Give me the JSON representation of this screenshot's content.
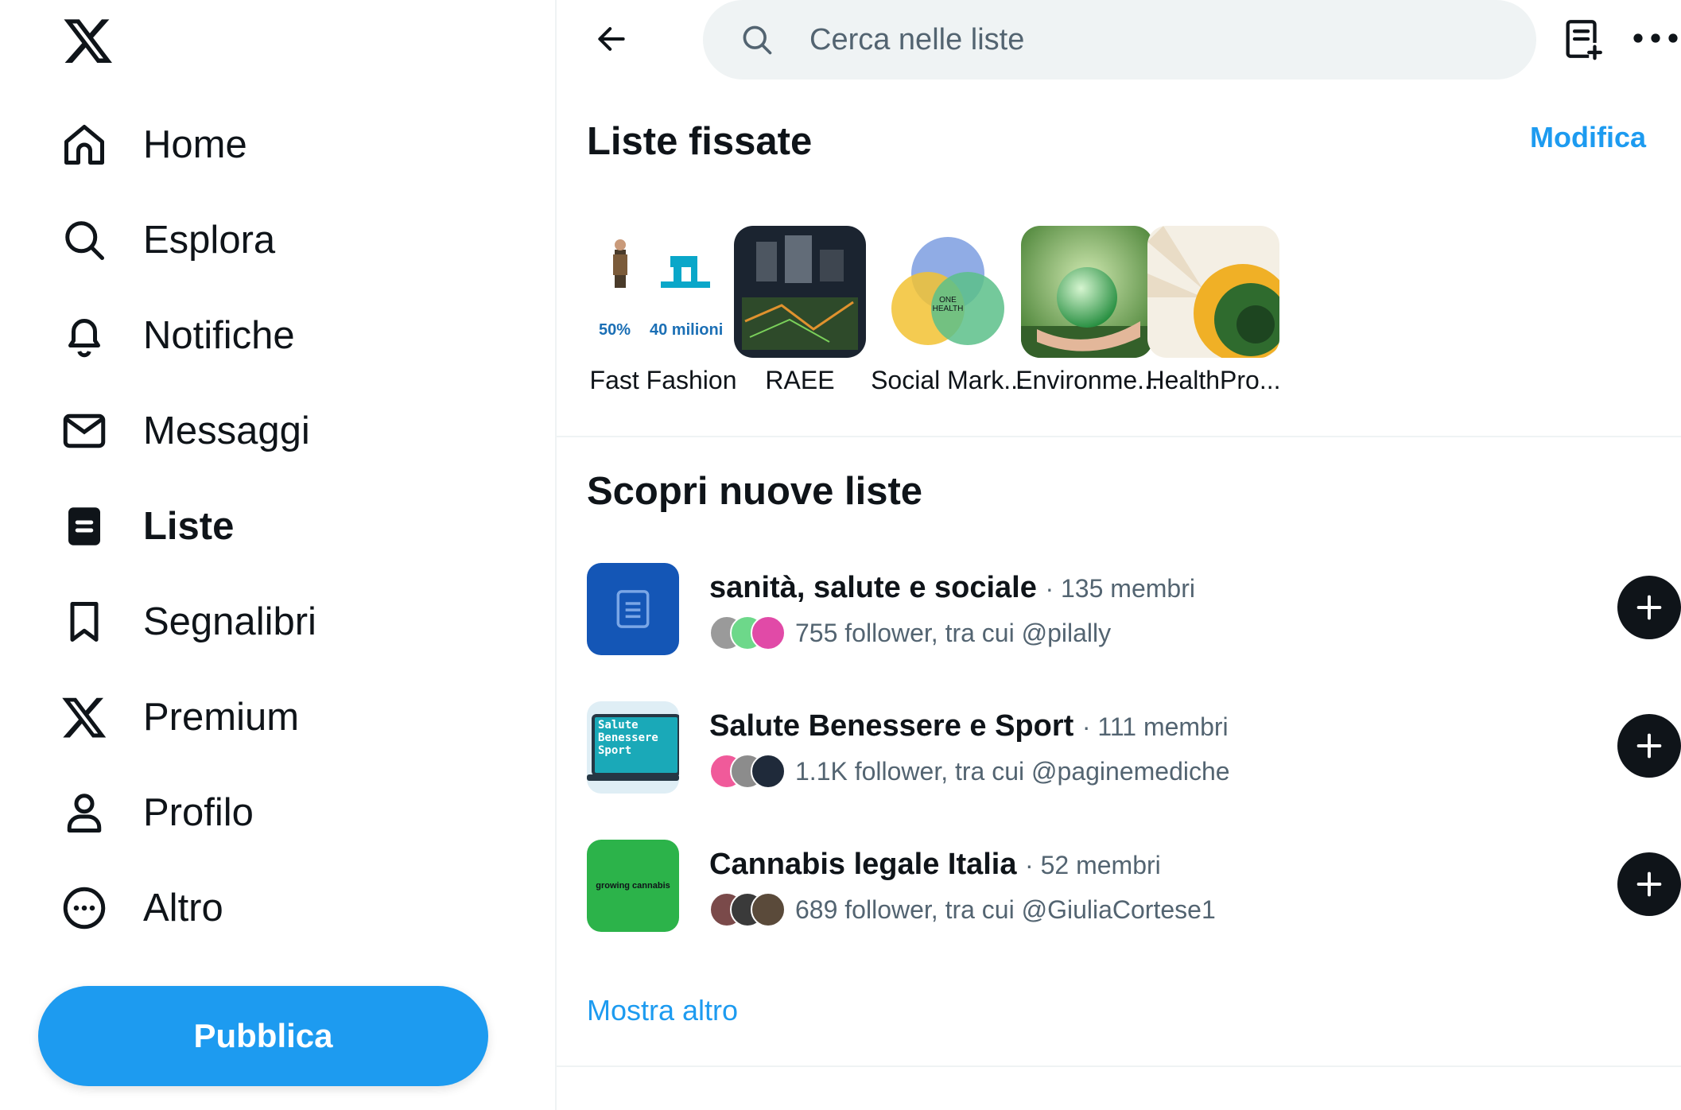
{
  "sidebar": {
    "items": [
      {
        "label": "Home",
        "icon": "home-icon"
      },
      {
        "label": "Esplora",
        "icon": "search-icon"
      },
      {
        "label": "Notifiche",
        "icon": "bell-icon"
      },
      {
        "label": "Messaggi",
        "icon": "mail-icon"
      },
      {
        "label": "Liste",
        "icon": "list-icon",
        "active": true
      },
      {
        "label": "Segnalibri",
        "icon": "bookmark-icon"
      },
      {
        "label": "Premium",
        "icon": "x-logo-icon"
      },
      {
        "label": "Profilo",
        "icon": "person-icon"
      },
      {
        "label": "Altro",
        "icon": "more-circle-icon"
      }
    ],
    "post_label": "Pubblica"
  },
  "header": {
    "search_placeholder": "Cerca nelle liste"
  },
  "pinned": {
    "title": "Liste fissate",
    "edit_label": "Modifica",
    "items": [
      {
        "name": "Fast Fashion",
        "thumb_text_1": "50%",
        "thumb_text_2": "40 milioni"
      },
      {
        "name": "RAEE"
      },
      {
        "name": "Social Mark...",
        "thumb_text": "ONE HEALTH"
      },
      {
        "name": "Environme..."
      },
      {
        "name": "HealthPro..."
      }
    ]
  },
  "discover": {
    "title": "Scopri nuove liste",
    "lists": [
      {
        "name": "sanità, salute e sociale",
        "members": "· 135 membri",
        "followers": "755 follower, tra cui @pilally"
      },
      {
        "name": "Salute Benessere e Sport",
        "members": "· 111 membri",
        "followers": "1.1K follower, tra cui @paginemediche",
        "thumb_text": "Salute Benessere Sport"
      },
      {
        "name": "Cannabis legale Italia",
        "members": "· 52 membri",
        "followers": "689 follower, tra cui @GiuliaCortese1",
        "thumb_text": "growing cannabis"
      }
    ],
    "show_more": "Mostra altro"
  },
  "colors": {
    "accent": "#1d9bf0",
    "text": "#0f1419",
    "muted": "#536471",
    "search_bg": "#eff3f4"
  }
}
